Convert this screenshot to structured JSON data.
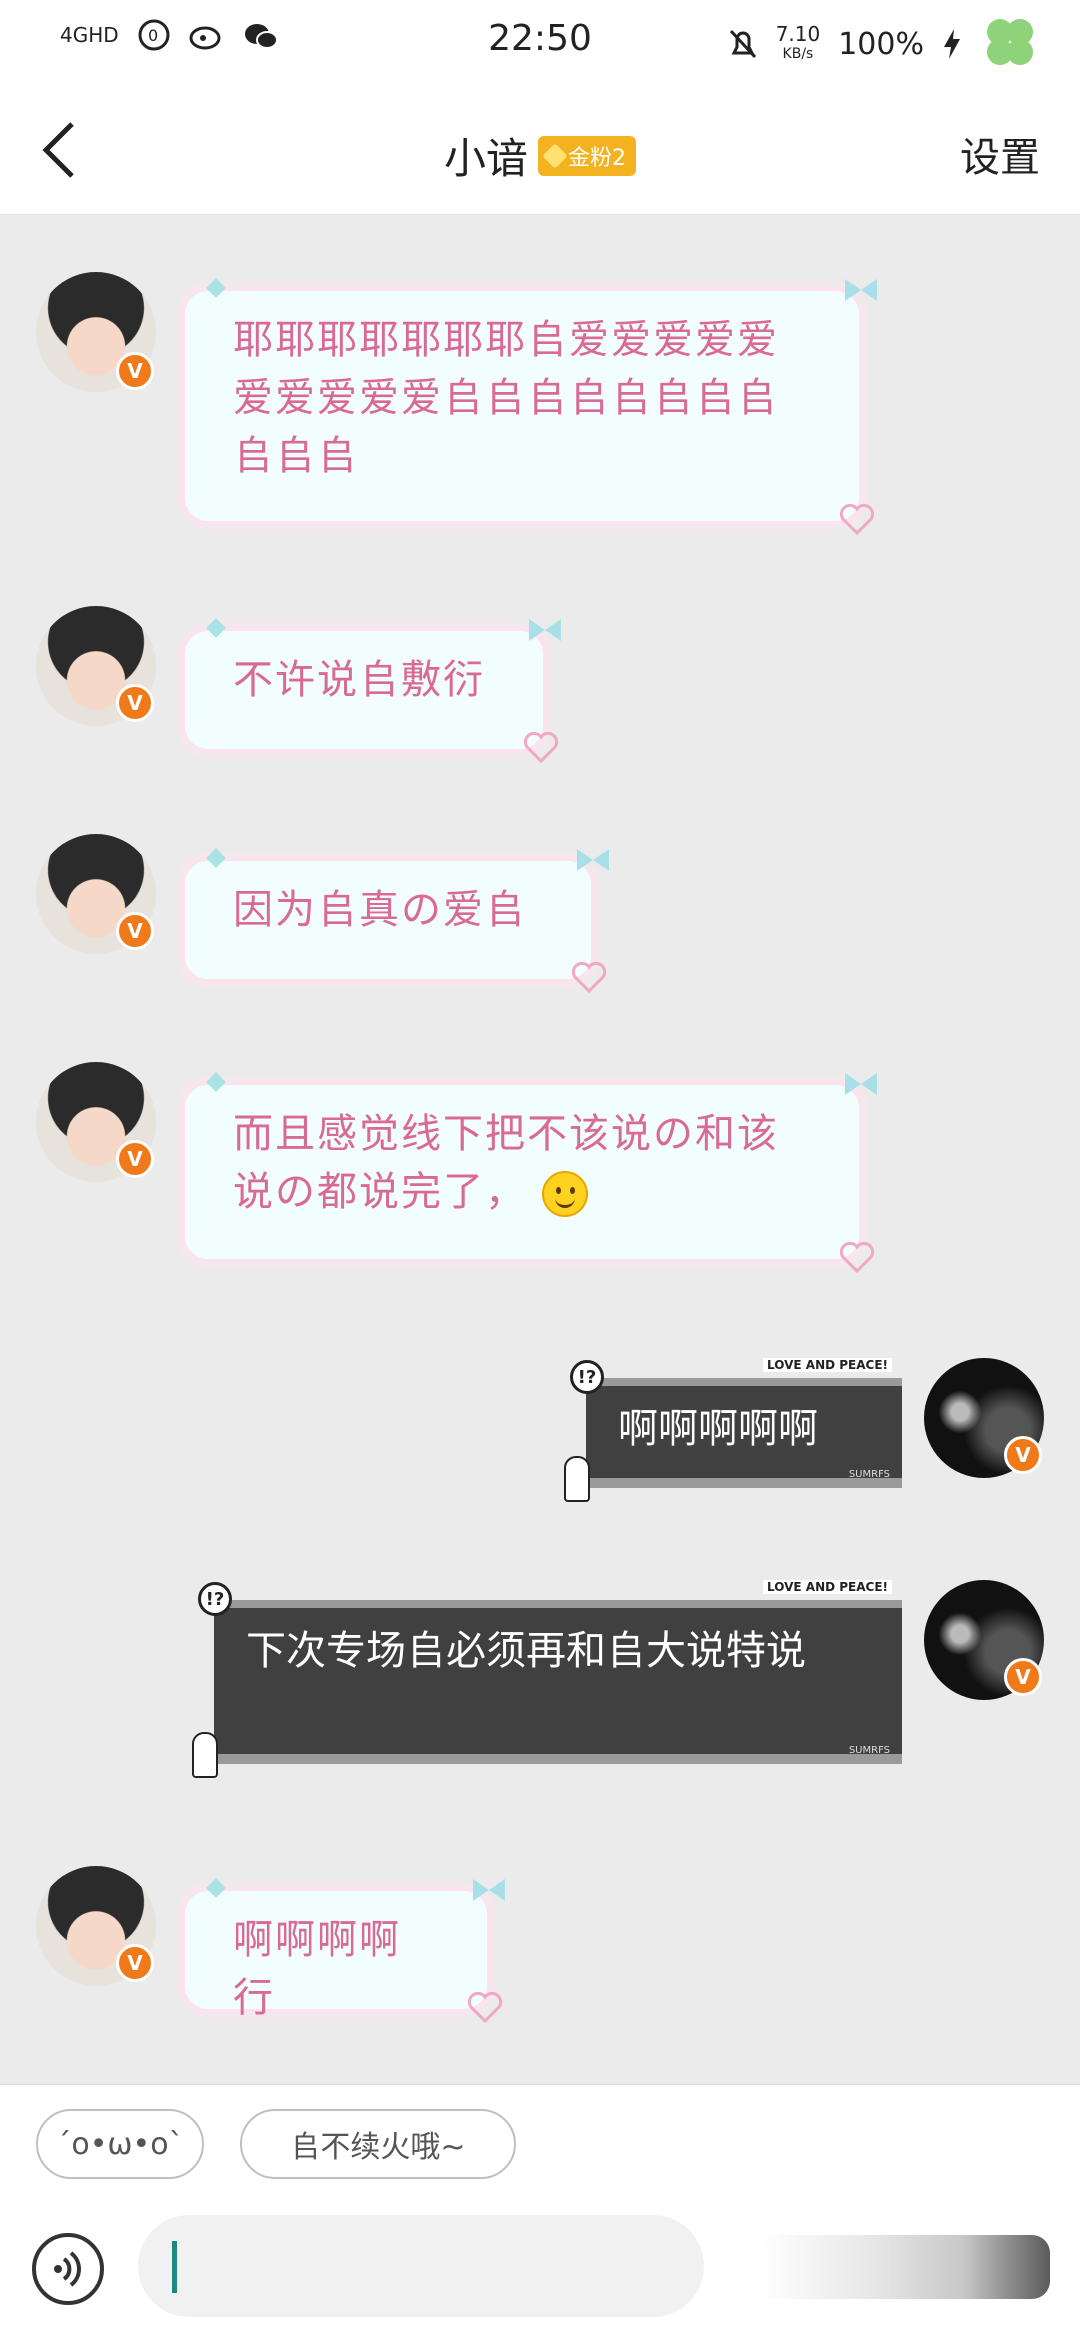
{
  "status": {
    "network": "4GHD",
    "time": "22:50",
    "speed_value": "7.10",
    "speed_unit": "KB/s",
    "battery": "100%"
  },
  "header": {
    "title": "小谙",
    "badge": "金粉2",
    "settings": "设置"
  },
  "messages": [
    {
      "text": "耶耶耶耶耶耶耶𠂤爱爱爱爱爱爱爱爱爱爱𠂤𠂤𠂤𠂤𠂤𠂤𠂤𠂤𠂤𠂤𠂤"
    },
    {
      "text": "不许说𠂤敷衍"
    },
    {
      "text": "因为𠂤真の爱𠂤"
    },
    {
      "text": "而且感觉线下把不该说の和该说の都说完了，"
    },
    {
      "text": "啊啊啊啊啊"
    },
    {
      "text": "下次专场𠂤必须再和𠂤大说特说"
    },
    {
      "text": "啊啊啊啊行"
    }
  ],
  "stickers": {
    "tag": "LOVE AND PEACE!",
    "brand": "SUMRFS",
    "question": "!?"
  },
  "quick_replies": [
    "´o•ω•o`",
    "𠂤不续火哦~"
  ],
  "icons": {
    "back": "back-chevron-icon",
    "voice": "voice-icon",
    "verified": "verified-badge-icon"
  }
}
